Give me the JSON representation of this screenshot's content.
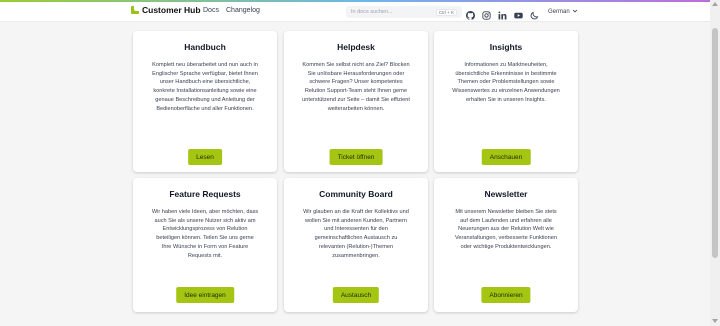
{
  "nav": {
    "brand": "Customer Hub",
    "links": [
      "Docs",
      "Changelog"
    ],
    "search_placeholder": "In docs suchen...",
    "search_shortcut": "Ctrl + K",
    "language": "German"
  },
  "cards": [
    {
      "title": "Handbuch",
      "text": "Komplett neu überarbeitet und nun auch in Englischer Sprache verfügbar, bietet Ihnen unser Handbuch eine übersichtliche, konkrete Installationsanleitung sowie eine genaue Beschreibung und Anleitung der Bedienoberfläche und aller Funktionen.",
      "button": "Lesen"
    },
    {
      "title": "Helpdesk",
      "text": "Kommen Sie selbst nicht ans Ziel? Blocken Sie unlösbare Herausforderungen oder schwere Fragen? Unser kompetentes Relution Support-Team steht Ihnen gerne unterstützend zur Seite – damit Sie effizient weiterarbeiten können.",
      "button": "Ticket öffnen"
    },
    {
      "title": "Insights",
      "text": "Informationen zu Marktneuheiten, übersichtliche Erkenntnisse in bestimmte Themen oder Problemstellungen sowie Wissenswertes zu einzelnen Anwendungen erhalten Sie in unseren Insights.",
      "button": "Anschauen"
    },
    {
      "title": "Feature Requests",
      "text": "Wir haben viele Ideen, aber möchten, dass auch Sie als unsere Nutzer sich aktiv am Entwicklungsprozess von Relution beteiligen können. Teilen Sie uns gerne Ihre Wünsche in Form von Feature Requests mit.",
      "button": "Idee eintragen"
    },
    {
      "title": "Community Board",
      "text": "Wir glauben an die Kraft der Kollektivs und wollen Sie mit anderen Kunden, Partnern und Interessenten für den gemeinschaftlichen Austausch zu relevanten (Relution-)Themen zusammenbringen.",
      "button": "Austausch"
    },
    {
      "title": "Newsletter",
      "text": "Mit unserem Newsletter bleiben Sie stets auf dem Laufenden und erfahren alle Neuerungen aus der Relution Welt wie Veranstaltungen, verbesserte Funktionen oder wichtige Produktentwicklungen.",
      "button": "Abonnieren"
    }
  ],
  "colors": {
    "accent": "#a4c613",
    "brand": "#9cc11b"
  },
  "icons": [
    "github-icon",
    "instagram-icon",
    "linkedin-icon",
    "youtube-icon",
    "dark-mode-icon",
    "chevron-down-icon"
  ]
}
